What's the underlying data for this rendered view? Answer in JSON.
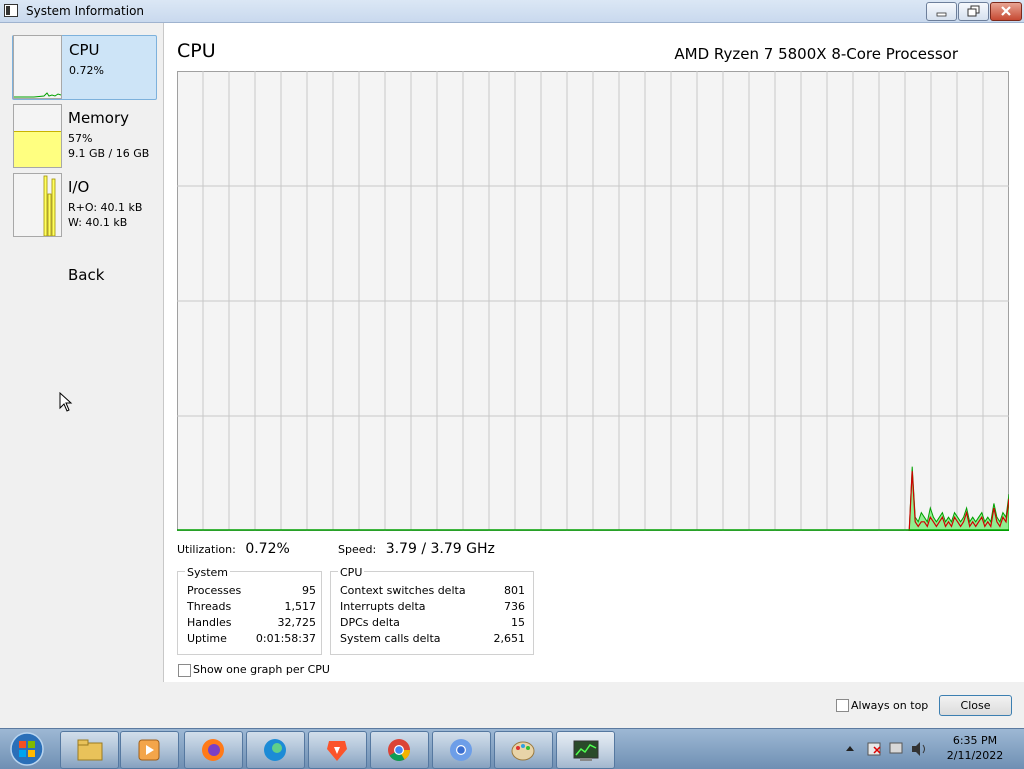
{
  "window": {
    "title": "System Information"
  },
  "nav": {
    "items": [
      {
        "label": "CPU",
        "line1": "0.72%",
        "line2": ""
      },
      {
        "label": "Memory",
        "line1": "57%",
        "line2": "9.1 GB / 16 GB",
        "fill_percent": 57
      },
      {
        "label": "I/O",
        "line1": "R+O: 40.1 kB",
        "line2": "W: 40.1 kB"
      }
    ],
    "back_label": "Back"
  },
  "cpu_panel": {
    "title": "CPU",
    "processor": "AMD Ryzen 7 5800X 8-Core Processor",
    "utilization_label": "Utilization:",
    "utilization_value": "0.72%",
    "speed_label": "Speed:",
    "speed_value": "3.79 / 3.79 GHz",
    "system_group": {
      "label": "System",
      "rows": [
        {
          "name": "Processes",
          "value": "95"
        },
        {
          "name": "Threads",
          "value": "1,517"
        },
        {
          "name": "Handles",
          "value": "32,725"
        },
        {
          "name": "Uptime",
          "value": "0:01:58:37"
        }
      ]
    },
    "cpu_group": {
      "label": "CPU",
      "rows": [
        {
          "name": "Context switches delta",
          "value": "801"
        },
        {
          "name": "Interrupts delta",
          "value": "736"
        },
        {
          "name": "DPCs delta",
          "value": "15"
        },
        {
          "name": "System calls delta",
          "value": "2,651"
        }
      ]
    },
    "one_graph_label": "Show one graph per CPU"
  },
  "footer": {
    "always_on_top_label": "Always on top",
    "close_label": "Close"
  },
  "graph_data": {
    "type": "area",
    "ylim": [
      0,
      100
    ],
    "recent_values": [
      0,
      14,
      3,
      2,
      4,
      3,
      2,
      5,
      3,
      2,
      3,
      4,
      2,
      3,
      2,
      4,
      3,
      2,
      3,
      5,
      2,
      3,
      2,
      3,
      4,
      2,
      3,
      2,
      6,
      3,
      2,
      4,
      3,
      8
    ],
    "recent_kernel_values": [
      0,
      13,
      2,
      1,
      2,
      2,
      1,
      3,
      2,
      1,
      2,
      3,
      1,
      2,
      1,
      3,
      2,
      1,
      2,
      4,
      1,
      2,
      1,
      2,
      3,
      1,
      2,
      1,
      5,
      2,
      1,
      3,
      2,
      7
    ],
    "colors": {
      "total": "#00c000",
      "kernel": "#e00000",
      "grid": "#c8c8c8"
    }
  },
  "taskbar": {
    "apps": [
      "explorer-icon",
      "media-player-icon",
      "firefox-icon",
      "edge-icon",
      "brave-icon",
      "chrome-icon",
      "chromium-icon",
      "paint-icon",
      "system-info-icon"
    ],
    "time": "6:35 PM",
    "date": "2/11/2022"
  }
}
